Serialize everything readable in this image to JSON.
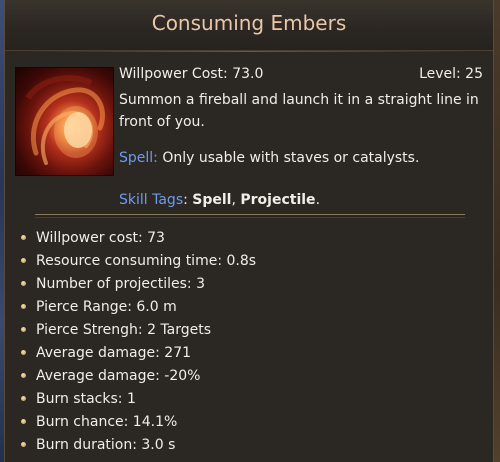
{
  "tooltip": {
    "title": "Consuming Embers",
    "willpower_cost_label": "Willpower Cost: 73.0",
    "level_label": "Level: 25",
    "description": "Summon a fireball and launch it in a straight line in front of you.",
    "requirement": {
      "keyword": "Spell:",
      "text": " Only usable with staves or catalysts."
    },
    "skill_tags": {
      "label": "Skill Tags",
      "sep": ": ",
      "tag1": "Spell",
      "comma": ", ",
      "tag2": "Projectile",
      "end": "."
    },
    "stats": [
      "Willpower cost: 73",
      "Resource consuming time: 0.8s",
      "Number of projectiles: 3",
      "Pierce Range: 6.0 m",
      "Pierce Strengh: 2 Targets",
      "Average damage: 271",
      "Average damage: -20%",
      "Burn stacks: 1",
      "Burn chance: 14.1%",
      "Burn duration: 3.0 s"
    ],
    "icon": "fireball-skill-icon"
  }
}
